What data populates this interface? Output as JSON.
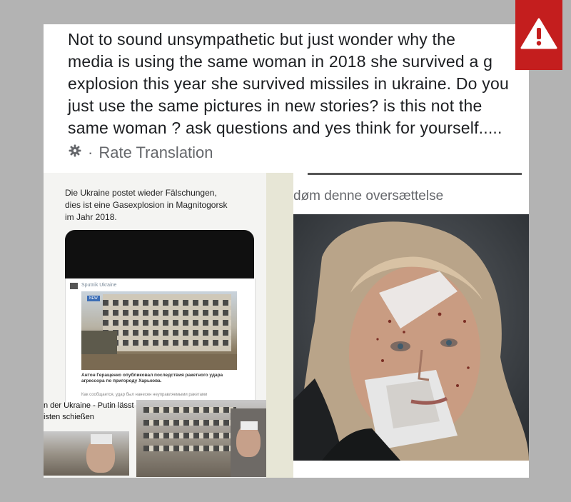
{
  "post": {
    "lines": [
      "Not to sound unsympathetic but just wonder why the",
      "media is using the same woman in 2018 she survived a g",
      "explosion this year she survived missiles in ukraine. Do you",
      "just use the same pictures in new stories? is this not the",
      "same woman ? ask questions and yes think for yourself....."
    ],
    "rate_translation": "Rate Translation",
    "rate_separator": "·"
  },
  "left_screenshot": {
    "tweet_lines": [
      "Die Ukraine postet wieder Fälschungen,",
      "dies ist eine Gasexplosion in Magnitogorsk",
      "im Jahr 2018."
    ],
    "card": {
      "source": "Sputnik Ukraine",
      "badge": "NEW",
      "caption": "Антон Геращенко опубликовал последствия ракетного удара агрессора по пригороду Харькова.",
      "subtext": "Как сообщается, удар был нанесен неуправляемыми ракетами"
    },
    "bottom_text_lines": [
      "n der Ukraine - Putin lässt",
      "isten schießen"
    ]
  },
  "right_screenshot": {
    "translation_label": "døm denne oversættelse"
  },
  "colors": {
    "background": "#b3b3b3",
    "warning": "#c41e1e",
    "text": "#1c1e21",
    "meta": "#65676b"
  },
  "icons": {
    "warning": "warning-triangle-icon",
    "rate": "gear-icon"
  }
}
